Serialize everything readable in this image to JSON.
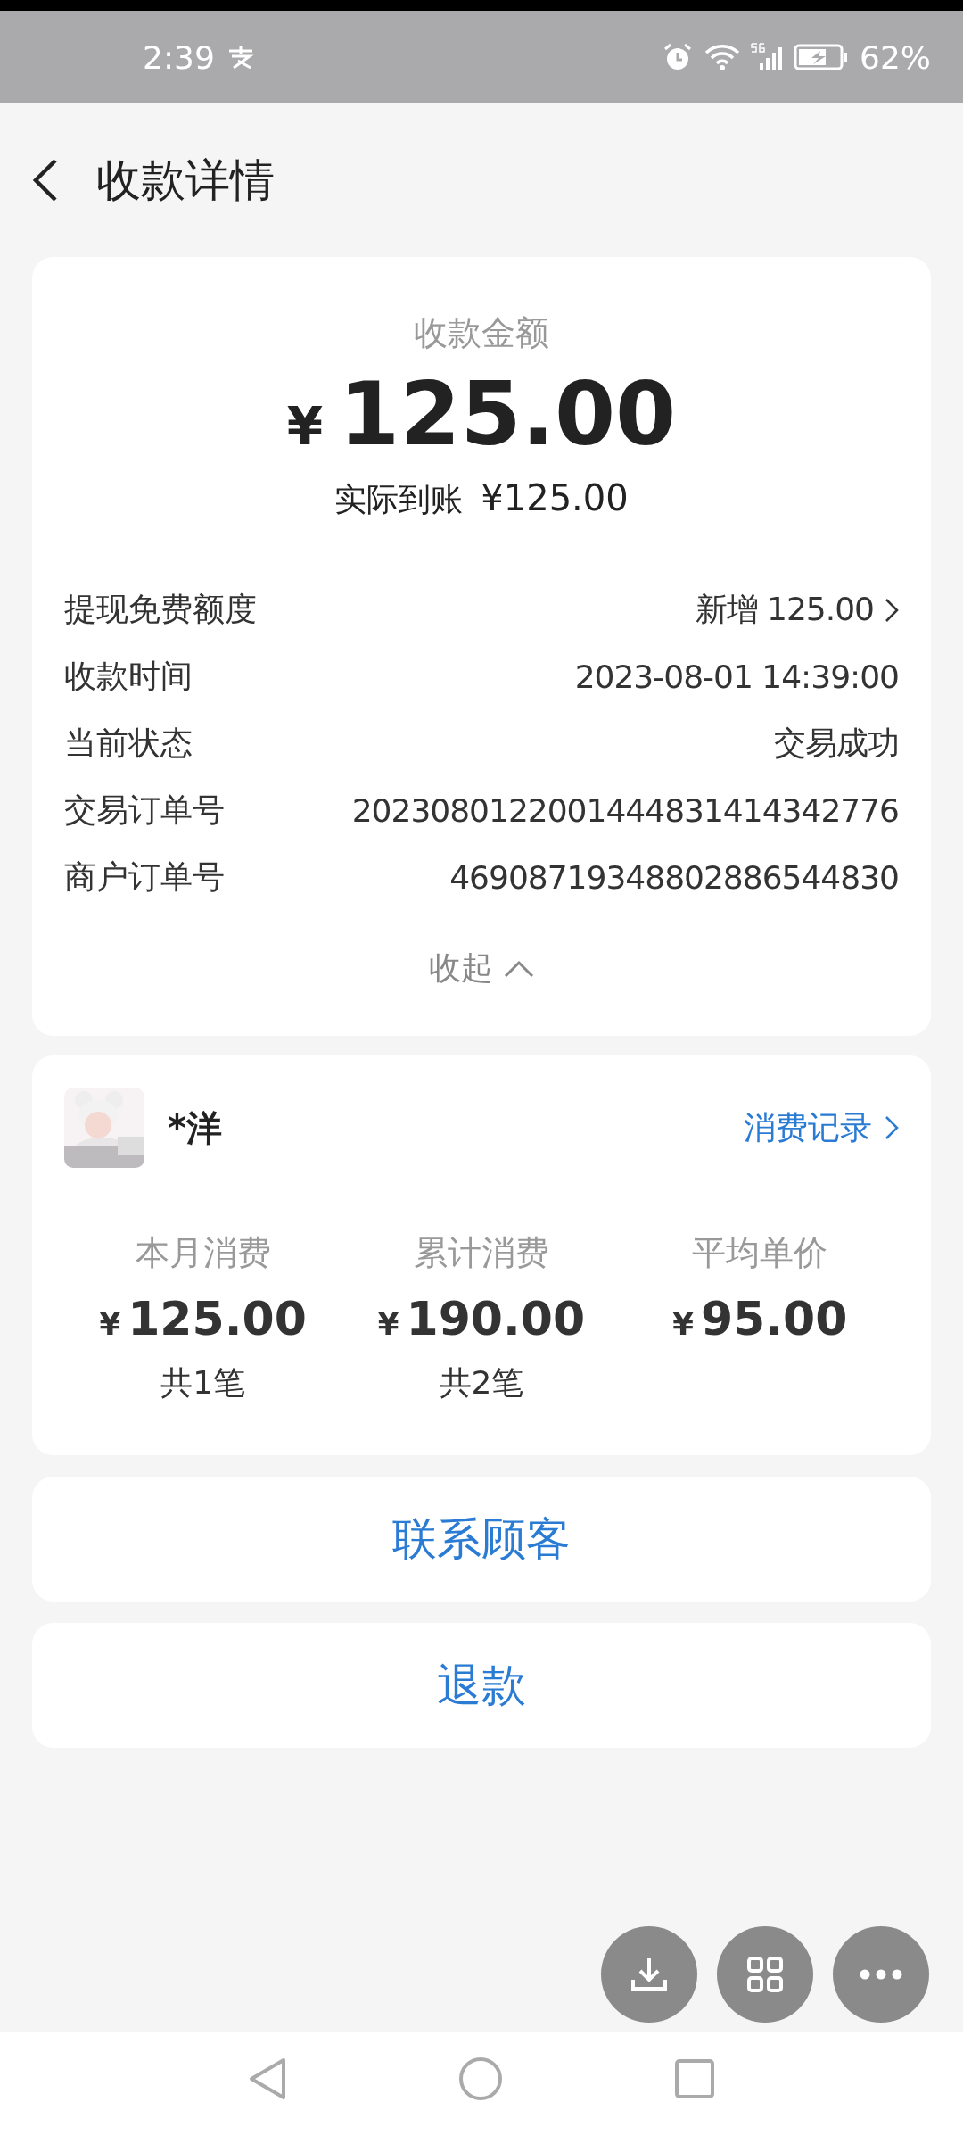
{
  "status_bar": {
    "time": "2:39",
    "battery": "62%"
  },
  "header": {
    "title": "收款详情"
  },
  "amount_card": {
    "label": "收款金额",
    "currency": "¥",
    "amount": "125.00",
    "received_label": "实际到账",
    "received": "¥125.00",
    "details": [
      {
        "label": "提现免费额度",
        "value": "新增 125.00",
        "kind": "link"
      },
      {
        "label": "收款时间",
        "value": "2023-08-01 14:39:00",
        "kind": "text"
      },
      {
        "label": "当前状态",
        "value": "交易成功",
        "kind": "text"
      },
      {
        "label": "交易订单号",
        "value": "2023080122001444831414342776",
        "kind": "text"
      },
      {
        "label": "商户订单号",
        "value": "46908719348802886544830",
        "kind": "text"
      }
    ],
    "collapse": "收起"
  },
  "customer": {
    "name": "*洋",
    "history_link": "消费记录",
    "stats": [
      {
        "label": "本月消费",
        "currency": "¥",
        "value": "125.00",
        "count": "共1笔"
      },
      {
        "label": "累计消费",
        "currency": "¥",
        "value": "190.00",
        "count": "共2笔"
      },
      {
        "label": "平均单价",
        "currency": "¥",
        "value": "95.00"
      }
    ]
  },
  "actions": [
    "联系顾客",
    "退款"
  ]
}
